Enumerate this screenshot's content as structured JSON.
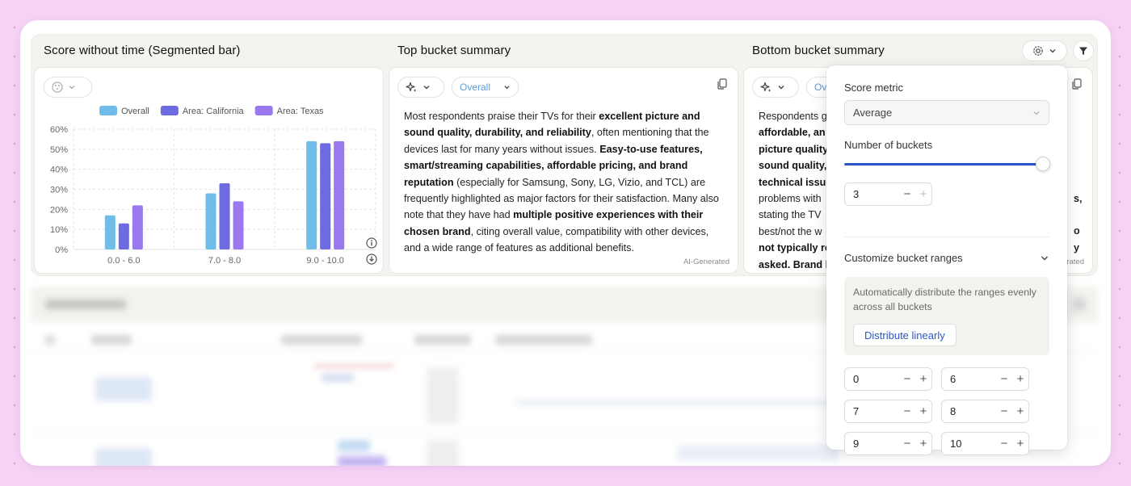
{
  "chart_section": {
    "title": "Score without time (Segmented bar)"
  },
  "top_summary": {
    "title": "Top bucket summary",
    "filter_label": "Overall",
    "text_segments": [
      {
        "t": "Most respondents praise their TVs for their ",
        "b": false
      },
      {
        "t": "excellent picture and sound quality, durability, and reliability",
        "b": true
      },
      {
        "t": ", often mentioning that the devices last for many years without issues. ",
        "b": false
      },
      {
        "t": "Easy-to-use features, smart/streaming capabilities, affordable pricing, and brand reputation",
        "b": true
      },
      {
        "t": " (especially for Samsung, Sony, LG, Vizio, and TCL) are frequently highlighted as major factors for their satisfaction. Many also note that they have had ",
        "b": false
      },
      {
        "t": "multiple positive experiences with their chosen brand",
        "b": true
      },
      {
        "t": ", citing overall value, compatibility with other devices, and a wide range of features as additional benefits.",
        "b": false
      }
    ],
    "ai_tag": "AI-Generated"
  },
  "bottom_summary": {
    "title": "Bottom bucket summary",
    "filter_label": "Ov",
    "text_segments": [
      {
        "t": "Respondents g",
        "b": false
      },
      {
        "t": "affordable, an",
        "b": true
      },
      {
        "t": "picture quality",
        "b": true
      },
      {
        "t": "sound quality,",
        "b": true
      },
      {
        "t": "technical issu",
        "b": true
      },
      {
        "t": "problems with",
        "b": false
      },
      {
        "t": "stating the TV",
        "b": false
      },
      {
        "t": "best/not the w",
        "b": false
      },
      {
        "t": "not typically re",
        "b": true
      },
      {
        "t": "asked. Brand l",
        "b": true
      }
    ],
    "right_fragments": [
      "s,",
      "o",
      "y"
    ],
    "ai_tag": "rated"
  },
  "chart_data": {
    "type": "bar",
    "categories": [
      "0.0 - 6.0",
      "7.0 - 8.0",
      "9.0 - 10.0"
    ],
    "series": [
      {
        "name": "Overall",
        "values": [
          17,
          28,
          54
        ],
        "color": "#6fbde8"
      },
      {
        "name": "Area: California",
        "values": [
          13,
          33,
          53
        ],
        "color": "#6e6ae0"
      },
      {
        "name": "Area: Texas",
        "values": [
          22,
          24,
          54
        ],
        "color": "#9a78ee"
      }
    ],
    "y_ticks": [
      "0%",
      "10%",
      "20%",
      "30%",
      "40%",
      "50%",
      "60%"
    ],
    "ylim": [
      0,
      60
    ],
    "legend_position": "top",
    "grid": true
  },
  "settings": {
    "score_metric_label": "Score metric",
    "score_metric_value": "Average",
    "num_buckets_label": "Number of buckets",
    "num_buckets_value": "3",
    "num_buckets_slider_fraction": 1.0,
    "customize_label": "Customize bucket ranges",
    "info_text": "Automatically distribute the ranges evenly across all buckets",
    "distribute_button": "Distribute linearly",
    "ranges": [
      {
        "min": "0",
        "max": "6"
      },
      {
        "min": "7",
        "max": "8"
      },
      {
        "min": "9",
        "max": "10"
      }
    ],
    "accent_color": "#2a56c6"
  }
}
